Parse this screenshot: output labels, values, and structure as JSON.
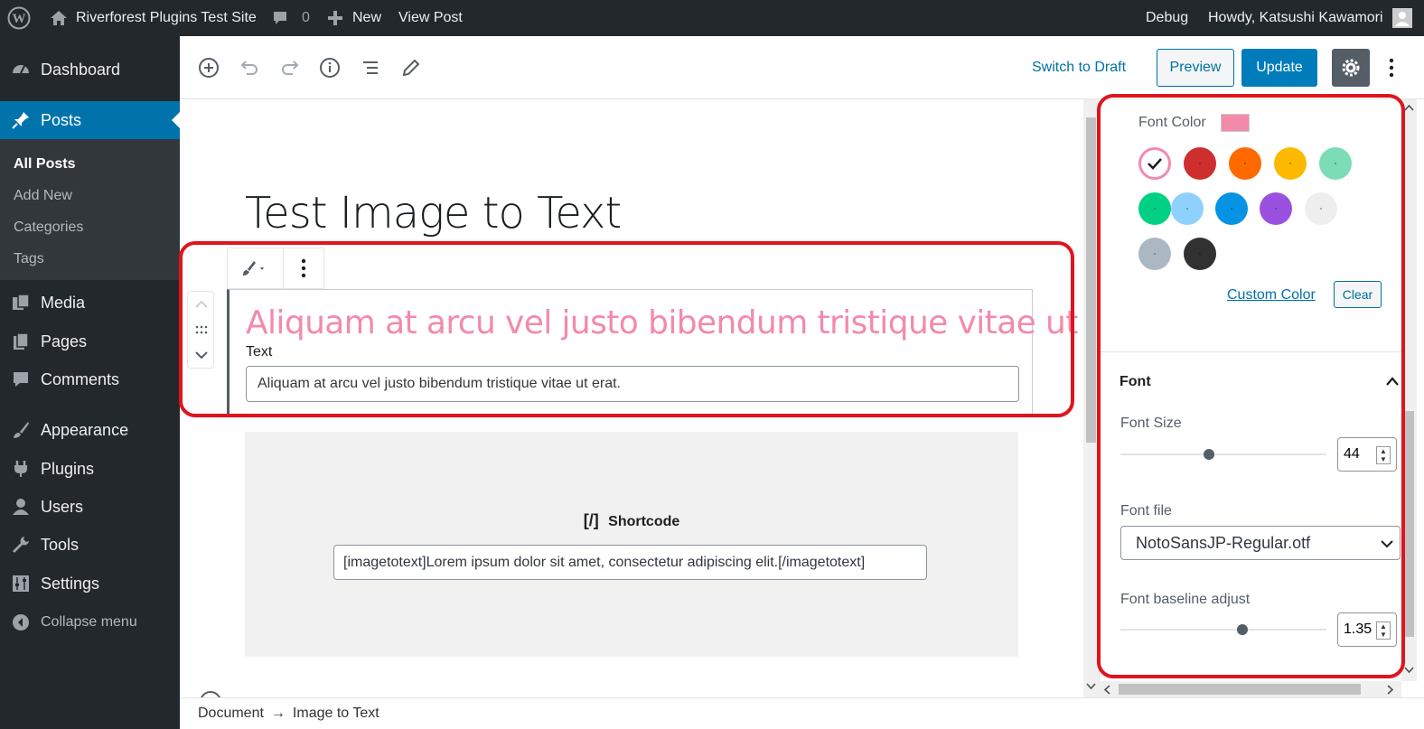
{
  "adminbar": {
    "site_name": "Riverforest Plugins Test Site",
    "comment_count": "0",
    "new_label": "New",
    "view_post": "View Post",
    "debug": "Debug",
    "howdy": "Howdy, Katsushi Kawamori"
  },
  "sidebar": {
    "dashboard": "Dashboard",
    "posts": "Posts",
    "posts_sub": [
      "All Posts",
      "Add New",
      "Categories",
      "Tags"
    ],
    "media": "Media",
    "pages": "Pages",
    "comments": "Comments",
    "appearance": "Appearance",
    "plugins": "Plugins",
    "users": "Users",
    "tools": "Tools",
    "settings": "Settings",
    "collapse": "Collapse menu"
  },
  "toolbar": {
    "switch_to_draft": "Switch to Draft",
    "preview": "Preview",
    "update": "Update"
  },
  "editor": {
    "post_title": "Test Image to Text",
    "block_heading": "Aliquam at arcu vel justo bibendum tristique vitae ut erat.",
    "text_label": "Text",
    "text_value": "Aliquam at arcu vel justo bibendum tristique vitae ut erat.",
    "shortcode_icon": "[/]",
    "shortcode_label": "Shortcode",
    "shortcode_value": "[imagetotext]Lorem ipsum dolor sit amet, consectetur adipiscing elit.[/imagetotext]"
  },
  "settings_panel": {
    "font_color_label": "Font Color",
    "selected_color": "#f38aa9",
    "palette": [
      "#f38aa9",
      "#cf2e2e",
      "#ff6900",
      "#fcb900",
      "#7bdcb5",
      "#00d084",
      "#8ed1fc",
      "#0693e3",
      "#9b51e0",
      "#eeeeee",
      "#abb8c3",
      "#313131"
    ],
    "custom_color": "Custom Color",
    "clear": "Clear",
    "font_section": "Font",
    "font_size_label": "Font Size",
    "font_size_value": "44",
    "font_size_level": 0.43,
    "font_file_label": "Font file",
    "font_file_value": "NotoSansJP-Regular.otf",
    "baseline_label": "Font baseline adjust",
    "baseline_value": "1.35",
    "baseline_level": 0.59
  },
  "footer": {
    "breadcrumb_1": "Document",
    "arrow": "→",
    "breadcrumb_2": "Image to Text"
  }
}
